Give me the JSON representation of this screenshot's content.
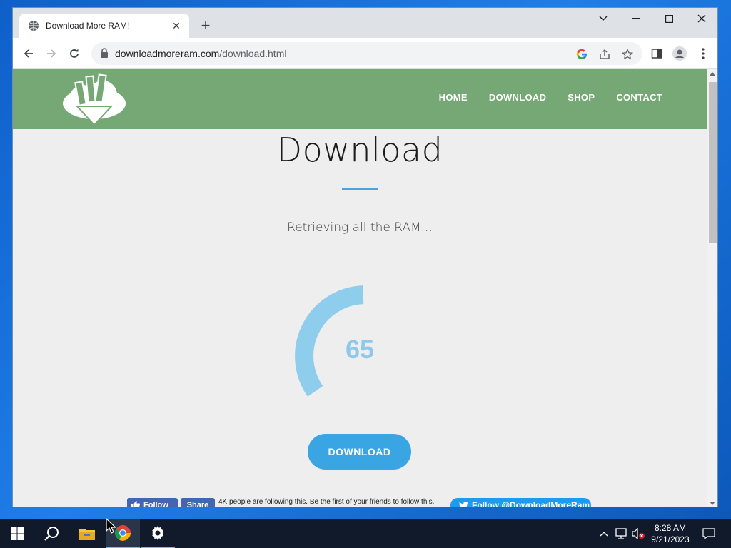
{
  "browser": {
    "tab_title": "Download More RAM!",
    "url_domain": "downloadmoreram.com",
    "url_path": "/download.html"
  },
  "site": {
    "nav": [
      "HOME",
      "DOWNLOAD",
      "SHOP",
      "CONTACT"
    ],
    "heading": "Download",
    "status": "Retrieving all the RAM...",
    "progress_value": "65",
    "progress_fraction": 0.65,
    "download_label": "DOWNLOAD",
    "accent_color": "#4aa3da",
    "header_color": "#76a876"
  },
  "social": {
    "fb_follow": "Follow",
    "fb_share": "Share",
    "fb_text": "4K people are following this. Be the first of your friends to follow this.",
    "twitter_follow": "Follow @DownloadMoreRam"
  },
  "taskbar": {
    "time": "8:28 AM",
    "date": "9/21/2023"
  }
}
